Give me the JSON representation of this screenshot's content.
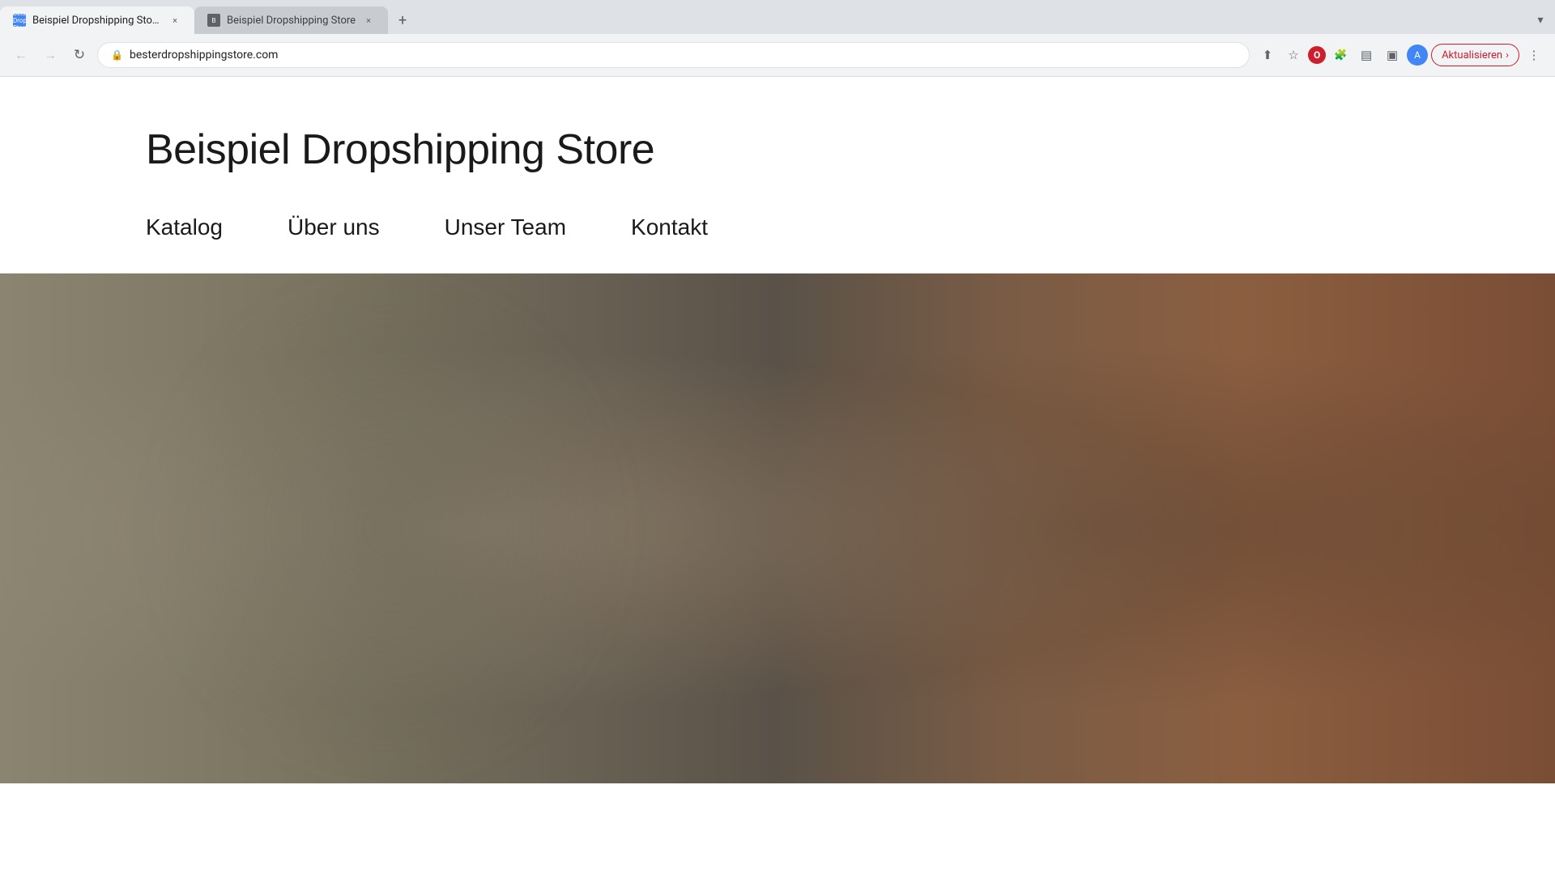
{
  "browser": {
    "tabs": [
      {
        "id": "tab1",
        "label": "Beispiel Dropshipping Store ·...",
        "favicon": "S",
        "active": true,
        "close_label": "×"
      },
      {
        "id": "tab2",
        "label": "Beispiel Dropshipping Store",
        "favicon": "S",
        "active": false,
        "close_label": "×"
      }
    ],
    "new_tab_label": "+",
    "dropdown_label": "▾",
    "address": "besterdropshippingstore.com",
    "nav": {
      "back_label": "←",
      "forward_label": "→",
      "reload_label": "↻"
    },
    "toolbar": {
      "share_label": "⬆",
      "bookmark_label": "☆",
      "opera_label": "O",
      "extensions_label": "⬛",
      "sidebar_label": "▤",
      "split_label": "▣",
      "profile_label": "A",
      "update_label": "Aktualisieren",
      "update_arrow": "›",
      "menu_label": "⋮"
    }
  },
  "website": {
    "title": "Beispiel Dropshipping Store",
    "nav": {
      "items": [
        {
          "id": "katalog",
          "label": "Katalog"
        },
        {
          "id": "uber-uns",
          "label": "Über uns"
        },
        {
          "id": "unser-team",
          "label": "Unser Team"
        },
        {
          "id": "kontakt",
          "label": "Kontakt"
        }
      ]
    }
  }
}
